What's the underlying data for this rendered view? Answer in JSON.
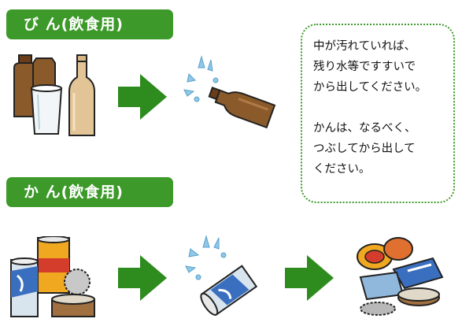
{
  "sections": [
    {
      "label": "び ん(飲食用)"
    },
    {
      "label": "か ん(飲食用)"
    }
  ],
  "note": {
    "paragraph1": [
      "中が汚れていれば、",
      "残り水等ですすいで",
      "から出してください。"
    ],
    "paragraph2": [
      "かんは、なるべく、",
      "つぶしてから出して",
      "ください。"
    ]
  },
  "colors": {
    "accent_green": "#3d9a2a",
    "arrow_green": "#2e8b1e",
    "bottle_brown": "#8b5a2b",
    "bottle_tan": "#e3c496",
    "splash_blue": "#8fc8e8"
  },
  "icons": [
    "bottles-illustration",
    "arrow-right-icon",
    "rinsed-bottle-illustration",
    "cans-illustration",
    "rinsed-can-illustration",
    "crushed-cans-illustration"
  ]
}
